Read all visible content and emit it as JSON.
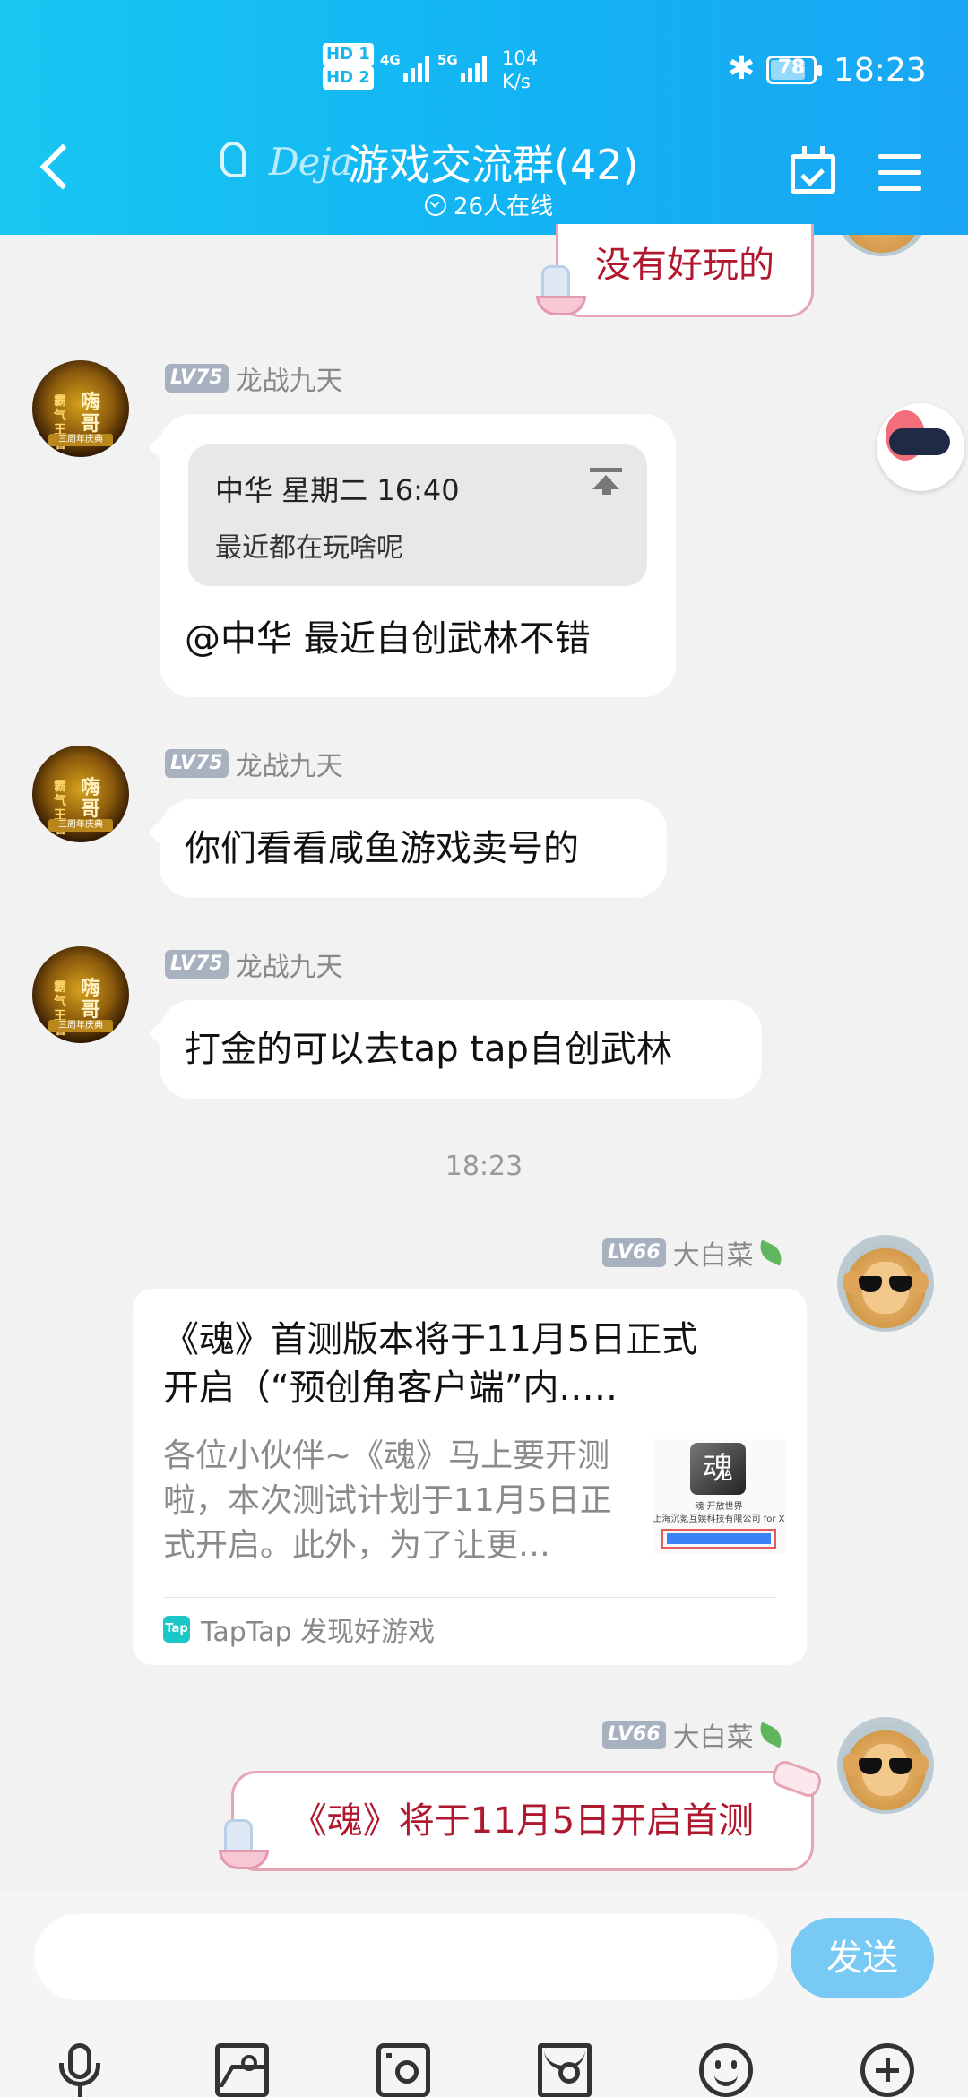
{
  "status_bar": {
    "hd1": "HD 1",
    "hd2": "HD 2",
    "net1": "4G",
    "net2": "5G",
    "speed_value": "104",
    "speed_unit": "K/s",
    "battery": "78",
    "time": "18:23"
  },
  "header": {
    "logo_text": "Deja",
    "title": "游戏交流群(42)",
    "online": "26人在线"
  },
  "messages": {
    "m0": {
      "text": "没有好玩的"
    },
    "m1": {
      "level": "LV75",
      "sender": "龙战九天",
      "quote_header": "中华 星期二 16:40",
      "quote_text": "最近都在玩啥呢",
      "text": "@中华 最近自创武林不错"
    },
    "m2": {
      "level": "LV75",
      "sender": "龙战九天",
      "text": "你们看看咸鱼游戏卖号的"
    },
    "m3": {
      "level": "LV75",
      "sender": "龙战九天",
      "text": "打金的可以去tap tap自创武林"
    },
    "time_divider": "18:23",
    "m4": {
      "level": "LV66",
      "sender": "大白菜",
      "card_title_line1": "《魂》首测版本将于11月5日正式",
      "card_title_line2": "开启（“预创角客户端”内.….",
      "card_desc_line1": "各位小伙伴~《魂》马上要开测",
      "card_desc_line2": "啦，本次测试计划于11月5日正",
      "card_desc_line3": "式开启。此外，为了让更…",
      "thumb_logo": "魂",
      "thumb_line1": "魂·开放世界",
      "thumb_line2": "上海沉氪互娱科技有限公司 for X",
      "thumb_button": "View in TapTap",
      "source": "TapTap 发现好游戏"
    },
    "m5": {
      "level": "LV66",
      "sender": "大白菜",
      "text": "《魂》将于11月5日开启首测"
    }
  },
  "avatars": {
    "dragon_big": "嗨哥",
    "dragon_small": "霸气王者",
    "dragon_banner": "三周年庆典"
  },
  "input": {
    "placeholder": "",
    "send_label": "发送"
  },
  "colors": {
    "header_gradient_start": "#19c7f2",
    "header_gradient_end": "#1aa6f4",
    "sticker_text": "#b01830",
    "send_button": "#79c9f5"
  }
}
